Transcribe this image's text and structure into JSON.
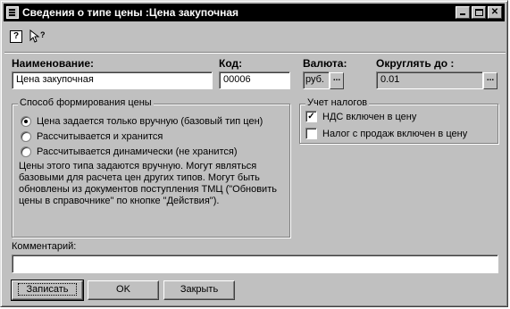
{
  "window": {
    "title": "Сведения о типе цены :Цена закупочная"
  },
  "fields": {
    "name_label": "Наименование:",
    "name_value": "Цена закупочная",
    "code_label": "Код:",
    "code_value": "00006",
    "currency_label": "Валюта:",
    "currency_value": "руб.",
    "round_label": "Округлять до :",
    "round_value": "0.01",
    "dots": "..."
  },
  "pricing": {
    "title": "Способ формирования цены",
    "options": [
      {
        "label": "Цена задается только вручную (базовый тип цен)",
        "selected": true
      },
      {
        "label": "Рассчитывается и хранится",
        "selected": false
      },
      {
        "label": "Рассчитывается динамически (не хранится)",
        "selected": false
      }
    ],
    "description": [
      "Цены этого типа задаются вручную. Могут являться",
      "базовыми для расчета цен других типов. Могут быть",
      "обновлены из документов поступления ТМЦ (\"Обновить",
      "цены в справочнике\" по кнопке \"Действия\")."
    ]
  },
  "taxes": {
    "title": "Учет налогов",
    "vat_label": "НДС включен в цену",
    "vat_checked": true,
    "sales_tax_label": "Налог с продаж включен в цену",
    "sales_tax_checked": false
  },
  "comment": {
    "label": "Комментарий:",
    "value": ""
  },
  "buttons": {
    "save": "Записать",
    "ok": "OK",
    "close": "Закрыть"
  }
}
